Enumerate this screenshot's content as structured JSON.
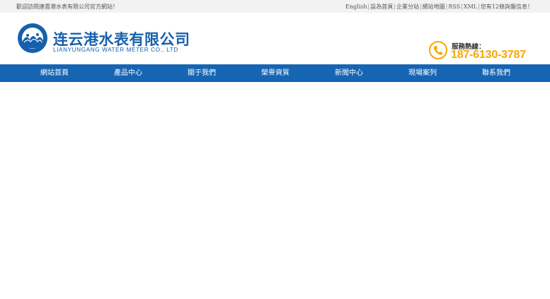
{
  "topbar": {
    "welcome": "歡迎訪問連雲港水表有限公司官方網站！",
    "links": [
      "English",
      "設為首頁",
      "企業分站",
      "網站地圖",
      "RSS",
      "XML",
      "您有12條詢盤信息！"
    ],
    "separator": "|"
  },
  "header": {
    "company_name": "连云港水表有限公司",
    "company_name_en": "LIANYUNGANG WATER METER CO., LTD",
    "hotline_label": "服務熱線：",
    "hotline_number": "187-6130-3787"
  },
  "colors": {
    "brand_blue": "#1565b3",
    "accent_orange": "#f5a800",
    "topbar_bg": "#f2f2f2"
  },
  "nav": {
    "items": [
      "網站首頁",
      "產品中心",
      "關于我們",
      "榮譽資質",
      "新聞中心",
      "現場案列",
      "聯系我們"
    ]
  }
}
